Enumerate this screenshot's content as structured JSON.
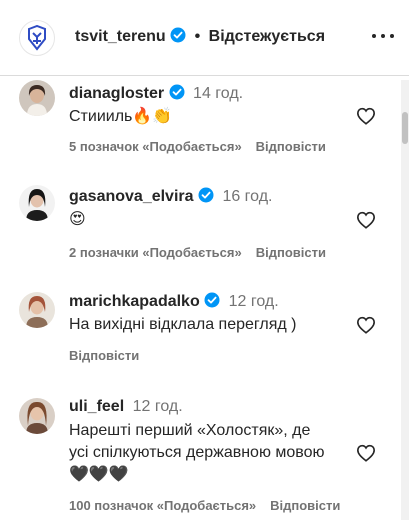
{
  "header": {
    "username": "tsvit_terenu",
    "separator": "•",
    "follow_status": "Відстежується"
  },
  "comments": [
    {
      "username": "dianagloster",
      "verified": true,
      "time": "14 год.",
      "text": "Стиииль🔥👏",
      "likes": "5 позначок «Подобається»",
      "reply": "Відповісти"
    },
    {
      "username": "gasanova_elvira",
      "verified": true,
      "time": "16 год.",
      "text": "😍",
      "likes": "2 позначки «Подобається»",
      "reply": "Відповісти"
    },
    {
      "username": "marichkapadalko",
      "verified": true,
      "time": "12 год.",
      "text": "На вихідні відклала перегляд )",
      "likes": "",
      "reply": "Відповісти"
    },
    {
      "username": "uli_feel",
      "verified": false,
      "time": "12 год.",
      "text": "Нарешті перший «Холостяк», де усі спілкуються державною мовою🖤🖤🖤",
      "likes": "100 позначок «Подобається»",
      "reply": "Відповісти"
    }
  ],
  "colors": {
    "text": "#262626",
    "secondary": "#737373",
    "verified": "#0095f6",
    "divider": "#dbdbdb"
  }
}
